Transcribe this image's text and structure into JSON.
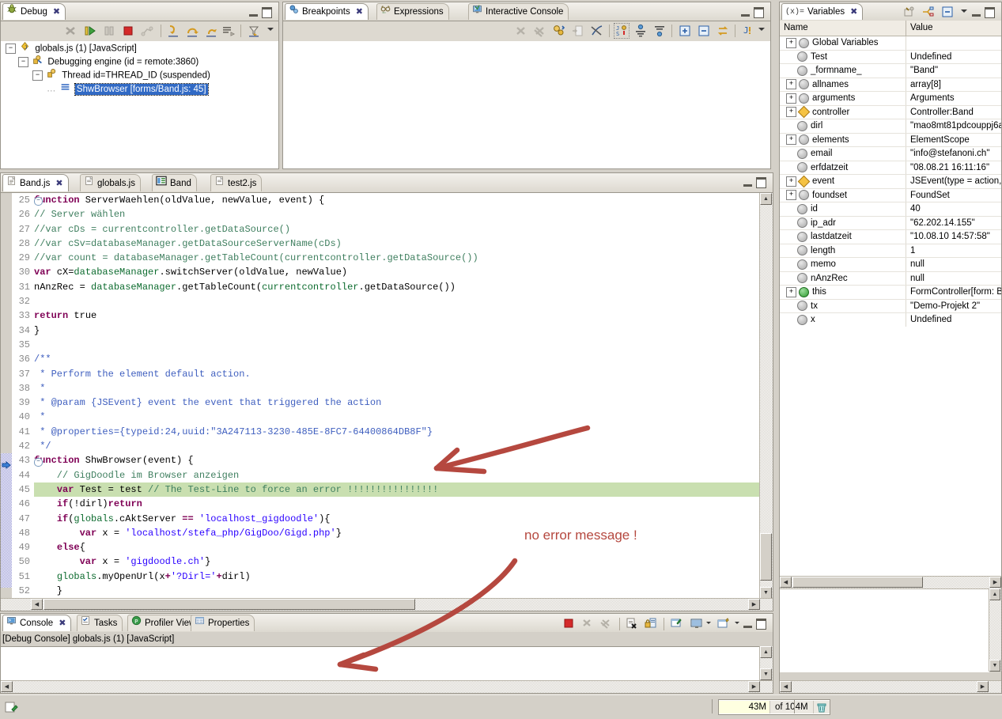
{
  "debug_view": {
    "tab_label": "Debug",
    "tab_icon": "bug-icon",
    "toolbar": [
      {
        "name": "disconnect-button",
        "title": "Disconnect",
        "enabled": false
      },
      {
        "name": "resume-button",
        "title": "Resume",
        "enabled": true
      },
      {
        "name": "suspend-button",
        "title": "Suspend",
        "enabled": false
      },
      {
        "name": "terminate-button",
        "title": "Terminate",
        "enabled": true
      },
      {
        "name": "disconnect-all-button",
        "title": "Disconnect All",
        "enabled": false
      },
      {
        "name": "step-into-button",
        "title": "Step Into",
        "enabled": true
      },
      {
        "name": "step-over-button",
        "title": "Step Over",
        "enabled": true
      },
      {
        "name": "step-return-button",
        "title": "Step Return",
        "enabled": true
      },
      {
        "name": "drop-to-frame-button",
        "title": "Drop to Frame",
        "enabled": true
      },
      {
        "name": "use-step-filters-button",
        "title": "Use Step Filters",
        "enabled": true
      },
      {
        "name": "view-menu-button",
        "title": "View Menu",
        "enabled": true
      }
    ],
    "tree": [
      {
        "label": "globals.js (1) [JavaScript]",
        "depth": 0,
        "expander": "-",
        "icon": "launch-icon",
        "selected": false
      },
      {
        "label": "Debugging engine (id = remote:3860)",
        "depth": 1,
        "expander": "-",
        "icon": "engine-icon",
        "selected": false
      },
      {
        "label": "Thread id=THREAD_ID (suspended)",
        "depth": 2,
        "expander": "-",
        "icon": "thread-icon",
        "selected": false
      },
      {
        "label": "ShwBrowser [forms/Band.js: 45]",
        "depth": 3,
        "expander": "",
        "icon": "stackframe-icon",
        "selected": true
      }
    ]
  },
  "breakpoints_view": {
    "tabs": [
      {
        "label": "Breakpoints",
        "icon": "breakpoint-icon",
        "active": true,
        "closeable": true
      },
      {
        "label": "Expressions",
        "icon": "expressions-icon",
        "active": false,
        "closeable": false
      },
      {
        "label": "Interactive Console",
        "icon": "console-icon",
        "active": false,
        "closeable": false
      }
    ],
    "toolbar": [
      {
        "name": "remove-breakpoint-button",
        "enabled": false
      },
      {
        "name": "remove-all-breakpoints-button",
        "enabled": false
      },
      {
        "name": "link-with-debug-view-button",
        "enabled": true
      },
      {
        "name": "goto-file-button",
        "enabled": false
      },
      {
        "name": "skip-all-breakpoints-button",
        "enabled": true
      },
      {
        "name": "sort-by-name-button",
        "enabled": true
      },
      {
        "name": "group-by-button",
        "enabled": true
      },
      {
        "name": "collapse-filter-button",
        "enabled": true
      },
      {
        "name": "expand-all-button",
        "enabled": true
      },
      {
        "name": "collapse-all-button",
        "enabled": true
      },
      {
        "name": "link-button",
        "enabled": true
      },
      {
        "name": "add-java-exception-button",
        "enabled": true
      },
      {
        "name": "view-menu-button",
        "enabled": true
      }
    ],
    "empty_list": ""
  },
  "variables_view": {
    "tab_label": "Variables",
    "tab_icon": "variables-icon",
    "toolbar": [
      {
        "name": "show-type-names-button"
      },
      {
        "name": "show-logical-structure-button"
      },
      {
        "name": "collapse-all-button"
      },
      {
        "name": "view-menu-button"
      }
    ],
    "columns": [
      "Name",
      "Value"
    ],
    "rows": [
      {
        "name": "Global Variables",
        "value": "",
        "expander": "+",
        "icon": "grey"
      },
      {
        "name": "Test",
        "value": "Undefined",
        "expander": "",
        "icon": "grey"
      },
      {
        "name": "_formname_",
        "value": "\"Band\"",
        "expander": "",
        "icon": "grey"
      },
      {
        "name": "allnames",
        "value": "array[8]",
        "expander": "+",
        "icon": "grey"
      },
      {
        "name": "arguments",
        "value": "Arguments",
        "expander": "+",
        "icon": "grey"
      },
      {
        "name": "controller",
        "value": "Controller:Band",
        "expander": "+",
        "icon": "diamond"
      },
      {
        "name": "dirl",
        "value": "\"mao8mt81pdcouppj6a",
        "expander": "",
        "icon": "grey"
      },
      {
        "name": "elements",
        "value": "ElementScope",
        "expander": "+",
        "icon": "grey"
      },
      {
        "name": "email",
        "value": "\"info@stefanoni.ch\"",
        "expander": "",
        "icon": "grey"
      },
      {
        "name": "erfdatzeit",
        "value": "\"08.08.21 16:11:16\"",
        "expander": "",
        "icon": "grey"
      },
      {
        "name": "event",
        "value": "JSEvent(type = action,",
        "expander": "+",
        "icon": "diamond"
      },
      {
        "name": "foundset",
        "value": "FoundSet",
        "expander": "+",
        "icon": "grey"
      },
      {
        "name": "id",
        "value": "40",
        "expander": "",
        "icon": "grey"
      },
      {
        "name": "ip_adr",
        "value": "\"62.202.14.155\"",
        "expander": "",
        "icon": "grey"
      },
      {
        "name": "lastdatzeit",
        "value": "\"10.08.10 14:57:58\"",
        "expander": "",
        "icon": "grey"
      },
      {
        "name": "length",
        "value": "1",
        "expander": "",
        "icon": "grey"
      },
      {
        "name": "memo",
        "value": "null",
        "expander": "",
        "icon": "grey"
      },
      {
        "name": "nAnzRec",
        "value": "null",
        "expander": "",
        "icon": "grey"
      },
      {
        "name": "this",
        "value": "FormController[form: B",
        "expander": "+",
        "icon": "green"
      },
      {
        "name": "tx",
        "value": "\"Demo-Projekt 2\"",
        "expander": "",
        "icon": "grey"
      },
      {
        "name": "x",
        "value": "Undefined",
        "expander": "",
        "icon": "grey"
      }
    ],
    "detail_pane": ""
  },
  "editor": {
    "tabs": [
      {
        "label": "Band.js",
        "icon": "js-file-icon",
        "active": true,
        "closeable": true
      },
      {
        "label": "globals.js",
        "icon": "js-file-icon",
        "active": false,
        "closeable": false
      },
      {
        "label": "Band",
        "icon": "form-icon",
        "active": false,
        "closeable": false
      },
      {
        "label": "test2.js",
        "icon": "js-file-icon",
        "active": false,
        "closeable": false
      }
    ],
    "first_line_number": 25,
    "highlighted_line": 45,
    "current_frame_line": 45,
    "lines": [
      {
        "n": 25,
        "fold": "-",
        "tokens": [
          {
            "t": "function",
            "c": "kw"
          },
          {
            "t": " ServerWaehlen(oldValue, newValue, event) {",
            "c": "op"
          }
        ]
      },
      {
        "n": 26,
        "tokens": [
          {
            "t": "// Server wählen",
            "c": "cm"
          }
        ]
      },
      {
        "n": 27,
        "tokens": [
          {
            "t": "//var cDs = currentcontroller.getDataSource()",
            "c": "cm"
          }
        ]
      },
      {
        "n": 28,
        "tokens": [
          {
            "t": "//var cSv=databaseManager.getDataSourceServerName(cDs)",
            "c": "cm"
          }
        ]
      },
      {
        "n": 29,
        "tokens": [
          {
            "t": "//var count = databaseManager.getTableCount(currentcontroller.getDataSource())",
            "c": "cm"
          }
        ]
      },
      {
        "n": 30,
        "tokens": [
          {
            "t": "var",
            "c": "kw"
          },
          {
            "t": " cX=",
            "c": "op"
          },
          {
            "t": "databaseManager",
            "c": "fn"
          },
          {
            "t": ".switchServer(oldValue, newValue)",
            "c": "op"
          }
        ]
      },
      {
        "n": 31,
        "tokens": [
          {
            "t": "nAnzRec = ",
            "c": "op"
          },
          {
            "t": "databaseManager",
            "c": "fn"
          },
          {
            "t": ".getTableCount(",
            "c": "op"
          },
          {
            "t": "currentcontroller",
            "c": "fn"
          },
          {
            "t": ".getDataSource())",
            "c": "op"
          }
        ]
      },
      {
        "n": 32,
        "tokens": []
      },
      {
        "n": 33,
        "tokens": [
          {
            "t": "return",
            "c": "kw"
          },
          {
            "t": " true",
            "c": "op"
          }
        ]
      },
      {
        "n": 34,
        "tokens": [
          {
            "t": "}",
            "c": "op"
          }
        ]
      },
      {
        "n": 35,
        "tokens": []
      },
      {
        "n": 36,
        "tokens": [
          {
            "t": "/**",
            "c": "doc"
          }
        ]
      },
      {
        "n": 37,
        "tokens": [
          {
            "t": " * Perform the element default action.",
            "c": "doc"
          }
        ]
      },
      {
        "n": 38,
        "tokens": [
          {
            "t": " *",
            "c": "doc"
          }
        ]
      },
      {
        "n": 39,
        "tokens": [
          {
            "t": " * @param {JSEvent} event the event that triggered the action",
            "c": "doc"
          }
        ]
      },
      {
        "n": 40,
        "tokens": [
          {
            "t": " *",
            "c": "doc"
          }
        ]
      },
      {
        "n": 41,
        "tokens": [
          {
            "t": " * @properties={typeid:24,uuid:\"3A247113-3230-485E-8FC7-64400864DB8F\"}",
            "c": "doc"
          }
        ]
      },
      {
        "n": 42,
        "tokens": [
          {
            "t": " */",
            "c": "doc"
          }
        ]
      },
      {
        "n": 43,
        "fold": "-",
        "tokens": [
          {
            "t": "function",
            "c": "kw"
          },
          {
            "t": " ShwBrowser(event) {",
            "c": "op"
          }
        ]
      },
      {
        "n": 44,
        "tokens": [
          {
            "t": "    // GigDoodle im Browser anzeigen",
            "c": "cm"
          }
        ]
      },
      {
        "n": 45,
        "highlight": true,
        "tokens": [
          {
            "t": "    ",
            "c": "op"
          },
          {
            "t": "var",
            "c": "kw"
          },
          {
            "t": " Test = test ",
            "c": "op"
          },
          {
            "t": "// The Test-Line to force an error !!!!!!!!!!!!!!!!",
            "c": "cm"
          }
        ]
      },
      {
        "n": 46,
        "tokens": [
          {
            "t": "    ",
            "c": "op"
          },
          {
            "t": "if",
            "c": "kw"
          },
          {
            "t": "(!dirl)",
            "c": "op"
          },
          {
            "t": "return",
            "c": "kw"
          }
        ]
      },
      {
        "n": 47,
        "tokens": [
          {
            "t": "    ",
            "c": "op"
          },
          {
            "t": "if",
            "c": "kw"
          },
          {
            "t": "(",
            "c": "op"
          },
          {
            "t": "globals",
            "c": "fn"
          },
          {
            "t": ".cAktServer ",
            "c": "op"
          },
          {
            "t": "==",
            "c": "kw"
          },
          {
            "t": " ",
            "c": "op"
          },
          {
            "t": "'localhost_gigdoodle'",
            "c": "str"
          },
          {
            "t": "){",
            "c": "op"
          }
        ]
      },
      {
        "n": 48,
        "tokens": [
          {
            "t": "        ",
            "c": "op"
          },
          {
            "t": "var",
            "c": "kw"
          },
          {
            "t": " x = ",
            "c": "op"
          },
          {
            "t": "'localhost/stefa_php/GigDoo/Gigd.php'",
            "c": "str"
          },
          {
            "t": "}",
            "c": "op"
          }
        ]
      },
      {
        "n": 49,
        "tokens": [
          {
            "t": "    ",
            "c": "op"
          },
          {
            "t": "else",
            "c": "kw"
          },
          {
            "t": "{",
            "c": "op"
          }
        ]
      },
      {
        "n": 50,
        "tokens": [
          {
            "t": "        ",
            "c": "op"
          },
          {
            "t": "var",
            "c": "kw"
          },
          {
            "t": " x = ",
            "c": "op"
          },
          {
            "t": "'gigdoodle.ch'",
            "c": "str"
          },
          {
            "t": "}",
            "c": "op"
          }
        ]
      },
      {
        "n": 51,
        "tokens": [
          {
            "t": "    ",
            "c": "op"
          },
          {
            "t": "globals",
            "c": "fn"
          },
          {
            "t": ".myOpenUrl(x",
            "c": "op"
          },
          {
            "t": "+",
            "c": "kw"
          },
          {
            "t": "'?Dirl='",
            "c": "str"
          },
          {
            "t": "+",
            "c": "kw"
          },
          {
            "t": "dirl)",
            "c": "op"
          }
        ]
      },
      {
        "n": 52,
        "tokens": [
          {
            "t": "    }",
            "c": "op"
          }
        ]
      },
      {
        "n": 53,
        "tokens": []
      }
    ]
  },
  "console_view": {
    "tabs": [
      {
        "label": "Console",
        "icon": "console-icon",
        "active": true,
        "closeable": true
      },
      {
        "label": "Tasks",
        "icon": "tasks-icon",
        "active": false,
        "closeable": false
      },
      {
        "label": "Profiler View",
        "icon": "profiler-icon",
        "active": false,
        "closeable": false
      },
      {
        "label": "Properties",
        "icon": "properties-icon",
        "active": false,
        "closeable": false
      }
    ],
    "toolbar": [
      {
        "name": "terminate-button",
        "enabled": true
      },
      {
        "name": "remove-launch-button",
        "enabled": false
      },
      {
        "name": "remove-all-terminated-button",
        "enabled": false
      },
      {
        "name": "clear-console-button",
        "enabled": true
      },
      {
        "name": "scroll-lock-button",
        "enabled": true
      },
      {
        "name": "pin-console-button",
        "enabled": true
      },
      {
        "name": "display-selected-console-button",
        "enabled": true
      },
      {
        "name": "open-console-button",
        "enabled": true
      }
    ],
    "header": "[Debug Console] globals.js (1) [JavaScript]",
    "body": ""
  },
  "status_bar": {
    "memory_used": "43M",
    "memory_total": "of 104M",
    "trash_icon": "trash-icon",
    "left_icon": "writable-icon"
  },
  "annotations": {
    "note_text": "no error message !",
    "color": "#b5483f",
    "arrow_top_name": "arrow-to-test-line",
    "arrow_bottom_name": "arrow-to-console"
  },
  "colors": {
    "chrome": "#d4d0c8",
    "selection_blue": "#316ac5",
    "highlight_green": "#c9dfb0",
    "annotation_red": "#b5483f",
    "keyword": "#7f0055",
    "comment": "#3f7f5f",
    "javadoc": "#3f5fbf",
    "string": "#2a00ff"
  }
}
